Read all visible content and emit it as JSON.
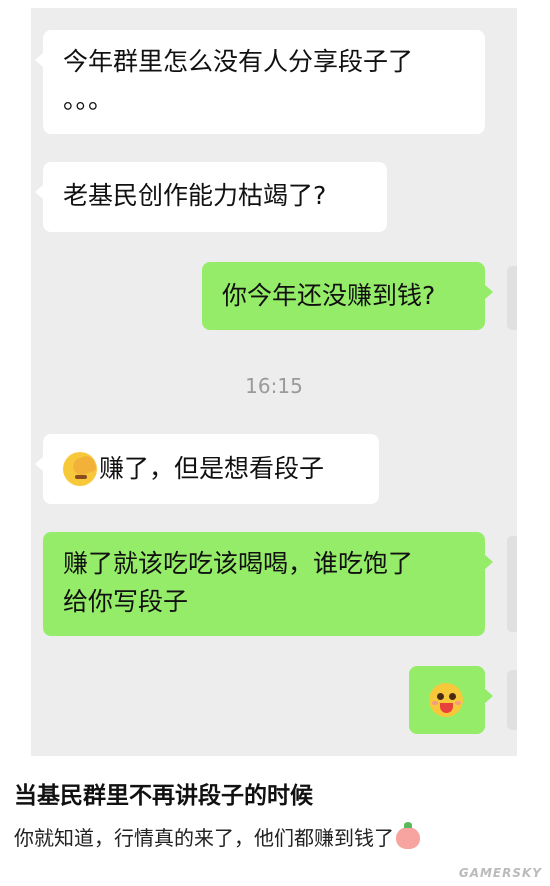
{
  "messages": [
    {
      "from": "other",
      "text_line1": "今年群里怎么没有人分享段子了",
      "text_line2": "。。。"
    },
    {
      "from": "other",
      "text": "老基民创作能力枯竭了?"
    },
    {
      "from": "me",
      "text": "你今年还没赚到钱?"
    },
    {
      "from": "other",
      "emoji": "facepalm-emoji",
      "text": "赚了，但是想看段子"
    },
    {
      "from": "me",
      "text_line1": "赚了就该吃吃该喝喝，谁吃饱了",
      "text_line2": "给你写段子"
    },
    {
      "from": "me",
      "emoji": "yum-emoji"
    }
  ],
  "timestamp": "16:15",
  "caption": {
    "title": "当基民群里不再讲段子的时候",
    "subtitle": "你就知道，行情真的来了，他们都赚到钱了",
    "subtitle_emoji": "peach-emoji"
  },
  "watermark": "GAMERSKY",
  "colors": {
    "chat_background": "#ededed",
    "incoming_bubble": "#ffffff",
    "outgoing_bubble": "#95ec69"
  }
}
